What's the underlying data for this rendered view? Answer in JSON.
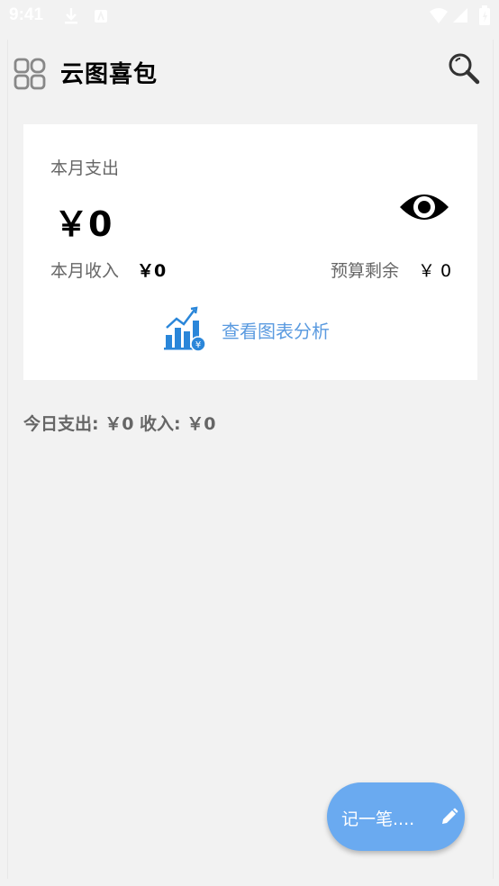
{
  "status_bar": {
    "time": "9:41",
    "icons": [
      "download-icon",
      "notification-icon",
      "wifi-icon",
      "signal-icon",
      "battery-icon"
    ]
  },
  "header": {
    "title": "云图喜包",
    "menu_icon": "grid-menu-icon",
    "search_icon": "search-icon"
  },
  "summary_card": {
    "month_expense_label": "本月支出",
    "month_expense_value": "￥0",
    "visibility_icon": "eye-icon",
    "month_income_label": "本月收入",
    "month_income_value": "￥0",
    "budget_remaining_label": "预算剩余",
    "budget_remaining_value": "￥ 0",
    "chart_link_label": "查看图表分析",
    "chart_link_icon": "chart-analysis-icon"
  },
  "today_summary": "今日支出: ￥0 收入: ￥0",
  "fab": {
    "label": "记一笔....",
    "icon": "pencil-icon"
  },
  "colors": {
    "background": "#f2f2f2",
    "card": "#ffffff",
    "accent_blue": "#5b9be0",
    "fab_blue": "#6aaaf0",
    "muted_text": "#666666"
  }
}
